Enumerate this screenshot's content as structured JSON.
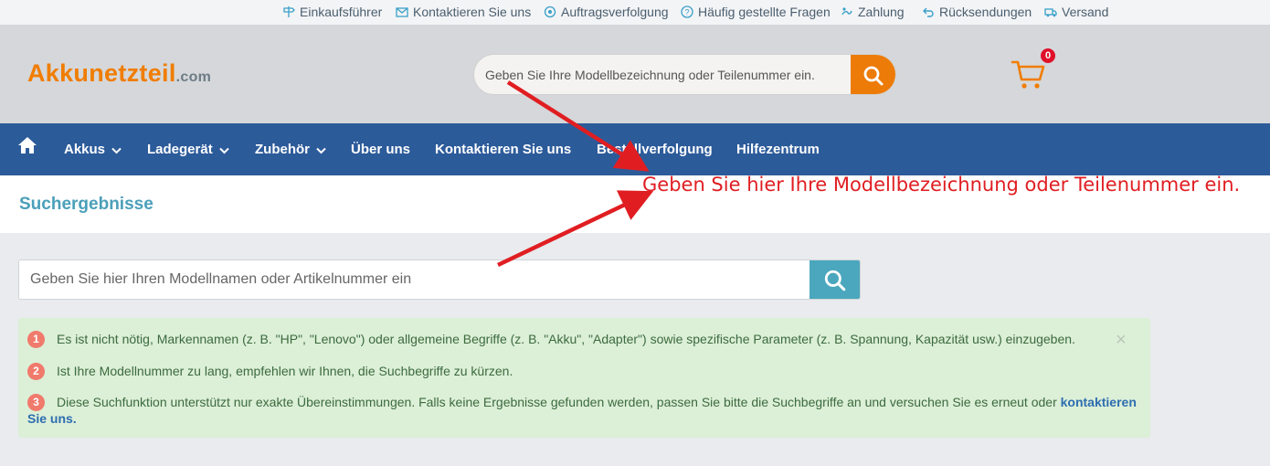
{
  "topbar": {
    "items": [
      {
        "label": "Einkaufsführer",
        "icon": "signpost-icon"
      },
      {
        "label": "Kontaktieren Sie uns",
        "icon": "mail-icon"
      },
      {
        "label": "Auftragsverfolgung",
        "icon": "tracking-icon"
      },
      {
        "label": "Häufig gestellte Fragen",
        "icon": "question-icon"
      },
      {
        "label": "Zahlung",
        "icon": "payment-icon"
      },
      {
        "label": "Rücksendungen",
        "icon": "return-icon"
      },
      {
        "label": "Versand",
        "icon": "truck-icon"
      }
    ]
  },
  "header": {
    "logo_main": "Akkunetzteil",
    "logo_tld": ".com",
    "search_placeholder": "Geben Sie Ihre Modellbezeichnung oder Teilenummer ein.",
    "cart_count": "0"
  },
  "nav": {
    "items": [
      {
        "label": "Akkus",
        "dropdown": true
      },
      {
        "label": "Ladegerät",
        "dropdown": true
      },
      {
        "label": "Zubehör",
        "dropdown": true
      },
      {
        "label": "Über uns",
        "dropdown": false
      },
      {
        "label": "Kontaktieren Sie uns",
        "dropdown": false
      },
      {
        "label": "Bestellverfolgung",
        "dropdown": false
      },
      {
        "label": "Hilfezentrum",
        "dropdown": false
      }
    ]
  },
  "results": {
    "title": "Suchergebnisse",
    "search_placeholder": "Geben Sie hier Ihren Modellnamen oder Artikelnummer ein"
  },
  "notice": {
    "items": [
      {
        "num": "1",
        "text": "Es ist nicht nötig, Markennamen (z. B. \"HP\", \"Lenovo\") oder allgemeine Begriffe (z. B. \"Akku\", \"Adapter\") sowie spezifische Parameter (z. B. Spannung, Kapazität usw.) einzugeben."
      },
      {
        "num": "2",
        "text": "Ist Ihre Modellnummer zu lang, empfehlen wir Ihnen, die Suchbegriffe zu kürzen."
      },
      {
        "num": "3",
        "text": "Diese Suchfunktion unterstützt nur exakte Übereinstimmungen. Falls keine Ergebnisse gefunden werden, passen Sie bitte die Suchbegriffe an und versuchen Sie es erneut oder ",
        "link": "kontaktieren Sie uns."
      }
    ],
    "close": "×"
  },
  "annotation": {
    "text": "Geben Sie hier Ihre Modellbezeichnung oder Teilenummer ein.",
    "color": "#e01e22"
  },
  "colors": {
    "brand_orange": "#f07d00",
    "nav_blue": "#2c5b9a",
    "search_teal": "#4aa7bd",
    "notice_green": "#dcefd7"
  }
}
